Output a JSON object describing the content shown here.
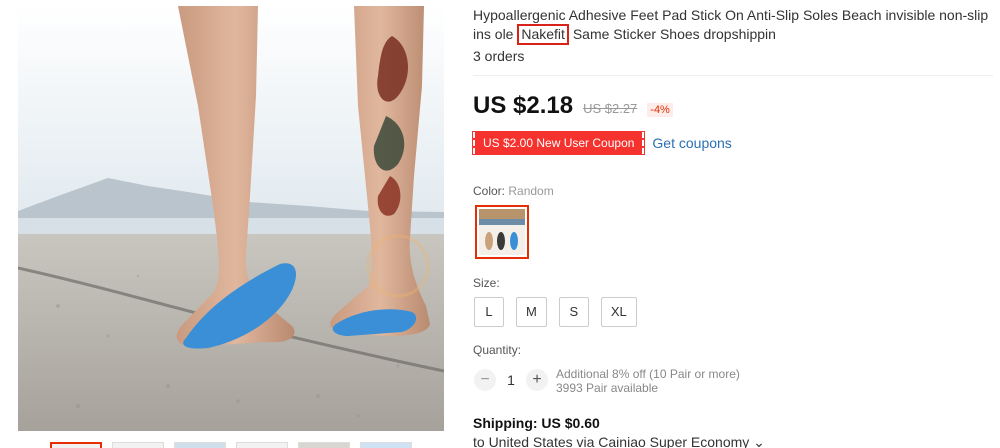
{
  "product": {
    "title_before": "Hypoallergenic Adhesive Feet Pad Stick On Anti-Slip Soles Beach invisible non-slip ins ole ",
    "title_highlight": "Nakefit",
    "title_after": " Same Sticker Shoes dropshippin",
    "orders": "3 orders"
  },
  "price": {
    "current": "US $2.18",
    "original": "US $2.27",
    "discount": "-4%"
  },
  "coupon": {
    "label": "US $2.00 New User Coupon",
    "link": "Get coupons"
  },
  "color": {
    "label": "Color:",
    "value": "Random"
  },
  "size": {
    "label": "Size:",
    "options": [
      "L",
      "M",
      "S",
      "XL"
    ]
  },
  "quantity": {
    "label": "Quantity:",
    "minus": "−",
    "value": "1",
    "plus": "+",
    "additional": "Additional 8% off (10 Pair or more)",
    "available": "3993 Pair available"
  },
  "shipping": {
    "label": "Shipping: US $0.60",
    "to": "to United States via Cainiao Super Economy ⌄"
  },
  "colors": {
    "accent": "#e62e04",
    "coupon_bg": "#f5322d",
    "link": "#2b6fb3",
    "pad_blue": "#3a8fd6"
  },
  "icons": {
    "gallery_image": "feet-on-beach-photo",
    "color_swatch": "foot-pads-swatch"
  }
}
